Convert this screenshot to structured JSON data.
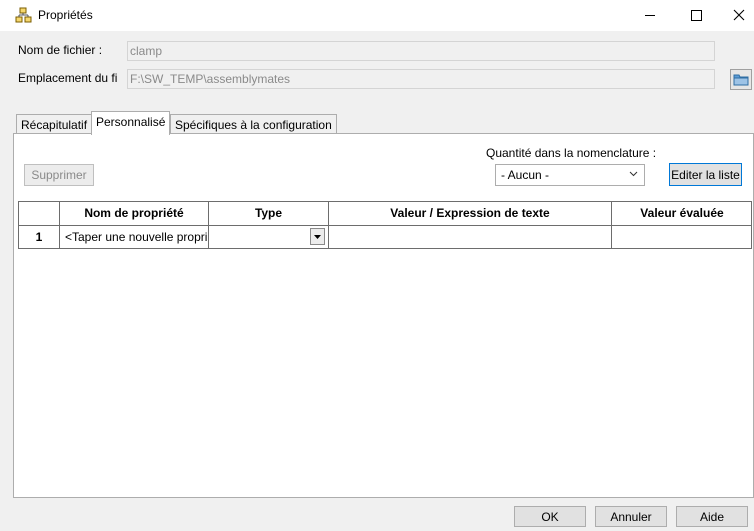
{
  "window": {
    "title": "Propriétés",
    "minimize_glyph": "—",
    "maximize_glyph": "☐",
    "close_glyph": "✕"
  },
  "fields": {
    "filename_label": "Nom de fichier :",
    "filename_value": "clamp",
    "location_label": "Emplacement du fi",
    "location_value": "F:\\SW_TEMP\\assemblymates"
  },
  "tabs": [
    {
      "label": "Récapitulatif"
    },
    {
      "label": "Personnalisé",
      "active": true
    },
    {
      "label": "Spécifiques à la configuration"
    }
  ],
  "toolbar": {
    "delete_label": "Supprimer",
    "bom_quantity_label": "Quantité dans la nomenclature :",
    "bom_quantity_value": "- Aucun -",
    "edit_list_label": "Editer la liste"
  },
  "grid": {
    "headers": [
      "",
      "Nom de propriété",
      "Type",
      "Valeur / Expression de texte",
      "Valeur évaluée"
    ],
    "rows": [
      {
        "num": "1",
        "name": "<Taper une nouvelle propri",
        "type": "",
        "value": "",
        "evaluated": ""
      }
    ]
  },
  "footer": {
    "ok_label": "OK",
    "cancel_label": "Annuler",
    "help_label": "Aide"
  },
  "colors": {
    "accent": "#0078d7",
    "background": "#f0f0f0"
  },
  "icons": {
    "app": "properties-icon",
    "folder": "folder-icon",
    "combo": "chevron-down-icon",
    "grid_dropdown": "triangle-down-icon"
  }
}
